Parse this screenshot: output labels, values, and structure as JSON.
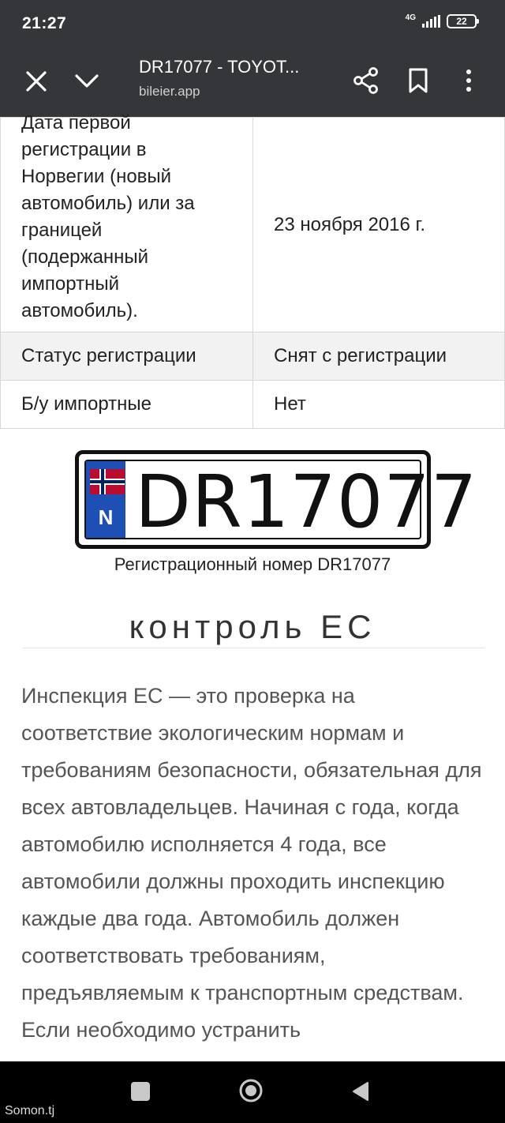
{
  "status_bar": {
    "time": "21:27",
    "network": "4G",
    "battery": "22"
  },
  "toolbar": {
    "title": "DR17077 - TOYOT...",
    "url": "bileier.app",
    "icons": [
      "close-icon",
      "chevron-down-icon",
      "share-icon",
      "bookmark-icon",
      "more-vert-icon"
    ]
  },
  "table": {
    "rows": [
      {
        "label": "Дата первой регистрации в Норвегии (новый автомобиль) или за границей (подержанный импортный автомобиль).",
        "value": "23 ноября 2016 г."
      },
      {
        "label": "Статус регистрации",
        "value": "Снят с регистрации"
      },
      {
        "label": "Б/у импортные",
        "value": "Нет"
      }
    ]
  },
  "plate": {
    "country": "N",
    "number": "DR17077",
    "caption": "Регистрационный номер DR17077",
    "band_color": "#1d4fb4"
  },
  "section": {
    "heading": "контроль ЕС",
    "paragraph": "Инспекция ЕС — это проверка на соответствие экологическим нормам и требованиям безопасности, обязательная для всех автовладельцев. Начиная с года, когда автомобилю исполняется 4 года, все автомобили должны проходить инспекцию каждые два года. Автомобиль должен соответствовать требованиям, предъявляемым к транспортным средствам. Если необходимо устранить"
  },
  "nav": {
    "icons": [
      "recents-icon",
      "home-icon",
      "back-icon"
    ]
  },
  "watermark": "Somon.tj"
}
